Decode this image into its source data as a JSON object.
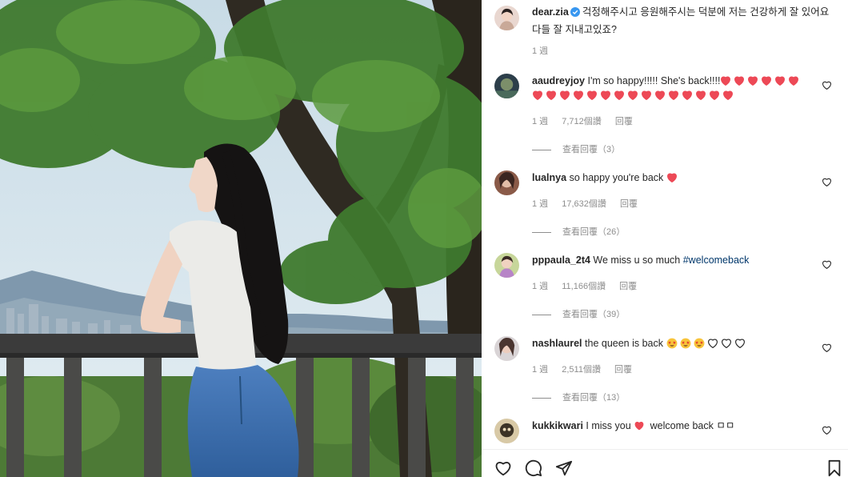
{
  "post": {
    "author": "dear.zia",
    "caption": "걱정해주시고 응원해주시는 덕분에 저는 건강하게 잘 있어요 다들 잘 지내고있죠?",
    "age": "1 週",
    "verified_icon": "verified-badge-icon",
    "accent_color": "#3897f0"
  },
  "comments": [
    {
      "username": "aaudreyjoy",
      "text": "I'm so happy!!!!! She's back!!!!",
      "emoji_hearts": 21,
      "age": "1 週",
      "likes": "7,712個讚",
      "reply": "回覆",
      "view_replies": "查看回覆（3）"
    },
    {
      "username": "lualnya",
      "text": "so happy you're back",
      "emoji_hearts": 1,
      "age": "1 週",
      "likes": "17,632個讚",
      "reply": "回覆",
      "view_replies": "查看回覆（26）"
    },
    {
      "username": "pppaula_2t4",
      "text": "We miss u so much",
      "hashtag": "#welcomeback",
      "age": "1 週",
      "likes": "11,166個讚",
      "reply": "回覆",
      "view_replies": "查看回覆（39）"
    },
    {
      "username": "nashlaurel",
      "text": "the queen is back",
      "emoji_faces": 3,
      "emoji_outline_hearts": 3,
      "age": "1 週",
      "likes": "2,511個讚",
      "reply": "回覆",
      "view_replies": "查看回覆（13）"
    },
    {
      "username": "kukkikwari",
      "text": "I miss you",
      "text_after": "welcome back ㅁㅁ"
    }
  ],
  "action_icons": [
    "heart-outline-icon",
    "comment-icon",
    "share-icon",
    "bookmark-icon"
  ],
  "colors": {
    "heart_red": "#ed4956",
    "muted": "#8e8e8e",
    "text": "#262626"
  }
}
